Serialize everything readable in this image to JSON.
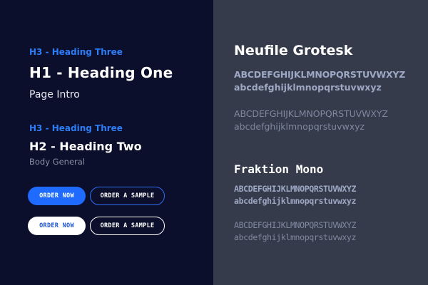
{
  "left": {
    "section1": {
      "h3": "H3 - Heading Three",
      "h1": "H1 - Heading One",
      "intro": "Page Intro"
    },
    "section2": {
      "h3": "H3 - Heading Three",
      "h2": "H2 - Heading Two",
      "body": "Body General"
    },
    "buttons": {
      "row1": {
        "primary": "ORDER NOW",
        "outline": "ORDER A SAMPLE"
      },
      "row2": {
        "primary": "ORDER NOW",
        "outline": "ORDER A SAMPLE"
      }
    }
  },
  "right": {
    "grotesk": {
      "title": "Neufile Grotesk",
      "bold_caps": "ABCDEFGHIJKLMNOPQRSTUVWXYZ",
      "bold_lower": "abcdefghijklmnopqrstuvwxyz",
      "light_caps": "ABCDEFGHIJKLMNOPQRSTUVWXYZ",
      "light_lower": "abcdefghijklmnopqrstuvwxyz"
    },
    "mono": {
      "title": "Fraktion Mono",
      "bold_caps": "ABCDEFGHIJKLMNOPQRSTUVWXYZ",
      "bold_lower": "abcdefghijklmnopqrstuvwxyz",
      "light_caps": "ABCDEFGHIJKLMNOPQRSTUVWXYZ",
      "light_lower": "abcdefghijklmnopqrstuvwxyz"
    }
  },
  "colors": {
    "left_bg": "#0b0f2b",
    "right_bg": "#353b4a",
    "accent_blue": "#1f6bff",
    "heading_blue": "#2d7df6"
  }
}
